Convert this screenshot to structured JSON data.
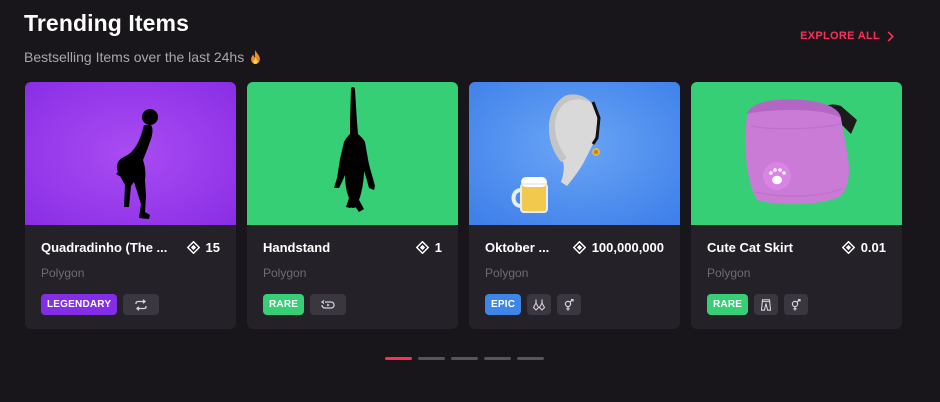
{
  "header": {
    "title": "Trending Items",
    "subtitle": "Bestselling Items over the last 24hs",
    "explore_label": "EXPLORE ALL"
  },
  "colors": {
    "accent": "#ff2e54",
    "legendary": "#842de6",
    "rare": "#36cf75",
    "epic": "#3d85e6",
    "card_bg": "#242129"
  },
  "cards": [
    {
      "name": "Quadradinho (The ...",
      "price": "15",
      "network": "Polygon",
      "rarity": "LEGENDARY",
      "thumb_color": "#8a2ee6",
      "icons": [
        "loop-icon"
      ]
    },
    {
      "name": "Handstand",
      "price": "1",
      "network": "Polygon",
      "rarity": "RARE",
      "thumb_color": "#36cf75",
      "icons": [
        "play-once-icon"
      ]
    },
    {
      "name": "Oktober ...",
      "price": "100,000,000",
      "network": "Polygon",
      "rarity": "EPIC",
      "thumb_color": "#4b8dee",
      "icons": [
        "earring-icon",
        "unisex-icon"
      ]
    },
    {
      "name": "Cute Cat Skirt",
      "price": "0.01",
      "network": "Polygon",
      "rarity": "RARE",
      "thumb_color": "#36cf75",
      "icons": [
        "pants-icon",
        "unisex-icon"
      ]
    }
  ],
  "pager": {
    "count": 5,
    "active": 0
  }
}
